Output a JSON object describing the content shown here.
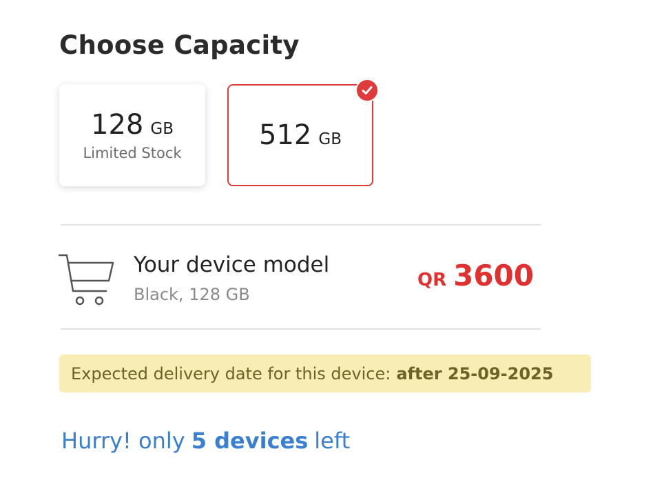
{
  "section": {
    "title": "Choose Capacity"
  },
  "capacity_options": [
    {
      "value": "128",
      "unit": "GB",
      "note": "Limited Stock",
      "selected": false
    },
    {
      "value": "512",
      "unit": "GB",
      "note": "",
      "selected": true
    }
  ],
  "summary": {
    "icon": "cart-icon",
    "title": "Your device model",
    "subtitle": "Black, 128 GB",
    "currency": "QR",
    "price": "3600"
  },
  "delivery": {
    "text": "Expected delivery date for this device:",
    "date": "after 25-09-2025"
  },
  "stock": {
    "prefix": "Hurry! only",
    "count_text": "5 devices",
    "suffix": "left"
  },
  "colors": {
    "accent_red": "#e03a3a",
    "link_blue": "#3a7fd0",
    "delivery_bg": "#f8eeb5",
    "delivery_text": "#6e6225"
  }
}
